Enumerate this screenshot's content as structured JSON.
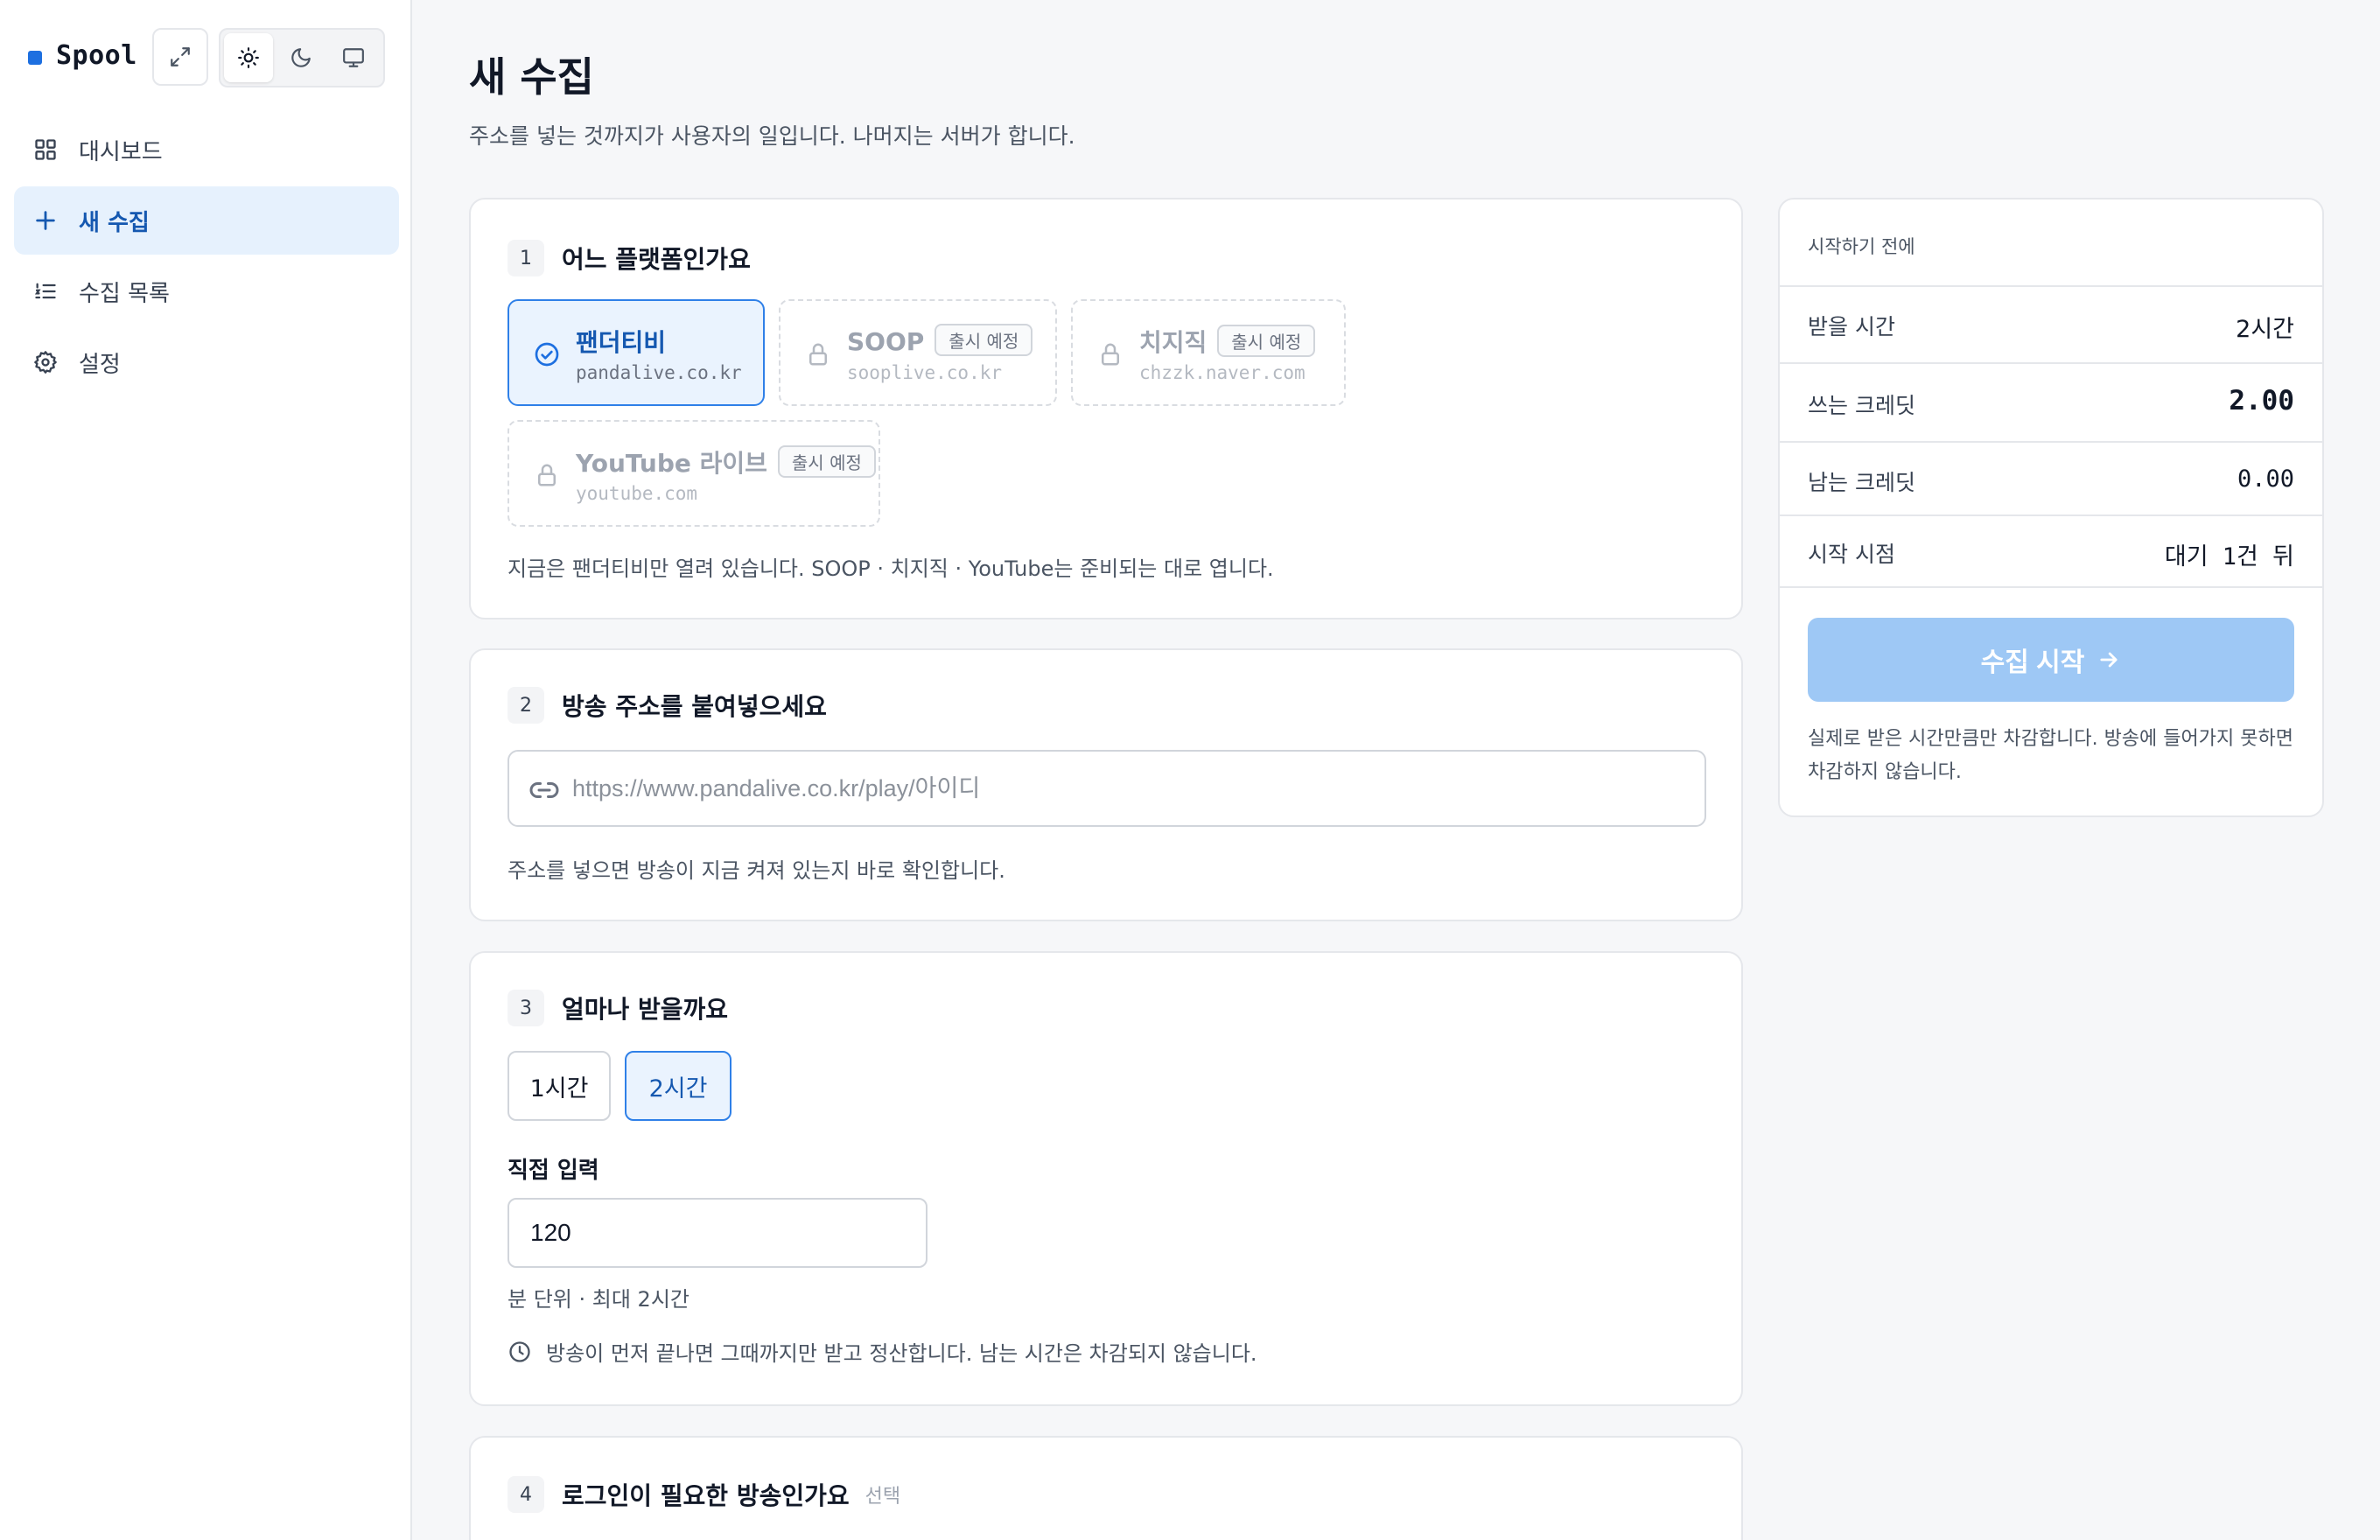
{
  "brand": {
    "name": "Spool",
    "accent": "#1d6fe0"
  },
  "sidebar": {
    "items": [
      {
        "label": "대시보드",
        "icon": "dashboard-icon"
      },
      {
        "label": "새 수집",
        "icon": "plus-icon",
        "active": true
      },
      {
        "label": "수집 목록",
        "icon": "list-icon"
      },
      {
        "label": "설정",
        "icon": "gear-icon"
      }
    ]
  },
  "page": {
    "title": "새 수집",
    "subtitle": "주소를 넣는 것까지가 사용자의 일입니다. 나머지는 서버가 합니다."
  },
  "step1": {
    "num": "1",
    "title": "어느 플랫폼인가요",
    "platforms": [
      {
        "name": "팬더티비",
        "domain": "pandalive.co.kr",
        "selected": true
      },
      {
        "name": "SOOP",
        "domain": "sooplive.co.kr",
        "badge": "출시 예정"
      },
      {
        "name": "치지직",
        "domain": "chzzk.naver.com",
        "badge": "출시 예정"
      },
      {
        "name": "YouTube 라이브",
        "domain": "youtube.com",
        "badge": "출시 예정"
      }
    ],
    "help": "지금은 팬더티비만 열려 있습니다. SOOP · 치지직 · YouTube는 준비되는 대로 엽니다."
  },
  "step2": {
    "num": "2",
    "title": "방송 주소를 붙여넣으세요",
    "placeholder": "https://www.pandalive.co.kr/play/아이디",
    "value": "",
    "help": "주소를 넣으면 방송이 지금 켜져 있는지 바로 확인합니다."
  },
  "step3": {
    "num": "3",
    "title": "얼마나 받을까요",
    "options": [
      "1시간",
      "2시간"
    ],
    "selected": "2시간",
    "custom_label": "직접 입력",
    "custom_value": "120",
    "unit_help": "분 단위 · 최대 2시간",
    "note": "방송이 먼저 끝나면 그때까지만 받고 정산합니다. 남는 시간은 차감되지 않습니다."
  },
  "step4": {
    "num": "4",
    "title": "로그인이 필요한 방송인가요",
    "optional": "선택"
  },
  "summary": {
    "heading": "시작하기 전에",
    "rows": [
      {
        "key": "받을 시간",
        "value": "2시간"
      },
      {
        "key": "쓰는 크레딧",
        "value": "2.00"
      },
      {
        "key": "남는 크레딧",
        "value": "0.00"
      },
      {
        "key": "시작 시점",
        "value": "대기 1건 뒤"
      }
    ],
    "start_label": "수집 시작",
    "note": "실제로 받은 시간만큼만 차감합니다. 방송에 들어가지 못하면 차감하지 않습니다."
  }
}
